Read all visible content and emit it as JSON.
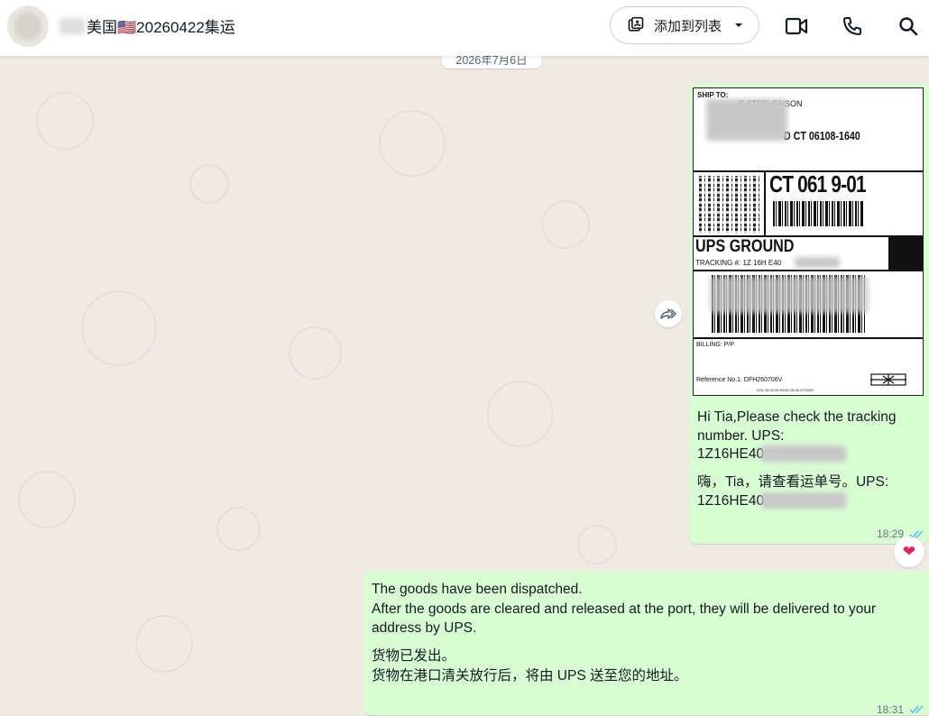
{
  "header": {
    "chat_title": "美国🇺🇸20260422集运",
    "add_to_list_label": "添加到列表",
    "icons": [
      "add-to-list-icon",
      "chevron-down-icon",
      "video-call-icon",
      "voice-call-icon",
      "search-icon"
    ]
  },
  "chat": {
    "date_divider": "2026年7月6日",
    "label": {
      "ship_to": "SHIP TO:",
      "name_fragment": "E STEPHENSON",
      "city_fragment": "D  CT  06108-1640",
      "route_code": "CT 061 9-01",
      "service": "UPS GROUND",
      "tracking_prefix": "TRACKING #: 1Z 16H E40",
      "billing": "BILLING: P/P",
      "reference": "Reference No.1: DFH260706V",
      "footer_tiny": "XOL 26.03.26          NV45 28.0A 07/2025"
    },
    "message1": {
      "line1": "Hi Tia,Please check the tracking number. UPS:",
      "line2": "1Z16HE40",
      "line3": "嗨，Tia，请查看运单号。UPS:",
      "line4": "1Z16HE40",
      "time": "18:29"
    },
    "reaction": "❤",
    "message2": {
      "line1": "The goods have been dispatched.",
      "line2": "After the goods are cleared and released at the port, they will be delivered to your address by UPS.",
      "line3": "货物已发出。",
      "line4": "货物在港口清关放行后，将由 UPS 送至您的地址。",
      "time": "18:31"
    }
  },
  "colors": {
    "chat_background": "#efeae2",
    "outgoing_bubble": "#d9fdd3",
    "read_ticks": "#53bdeb"
  }
}
